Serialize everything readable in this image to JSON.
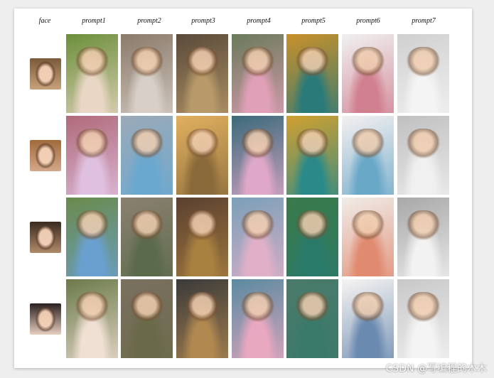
{
  "headers": [
    "face",
    "prompt1",
    "prompt2",
    "prompt3",
    "prompt4",
    "prompt5",
    "prompt6",
    "prompt7"
  ],
  "watermark": "CSDN @写编程的木木",
  "rows": [
    {
      "face_colors": [
        "#c9a27a",
        "#7a5a3a"
      ],
      "tiles": [
        [
          "#6b8f3a",
          "#e9d6c4"
        ],
        [
          "#8a7a6a",
          "#d8d0c8"
        ],
        [
          "#5a4a3a",
          "#b89a6a"
        ],
        [
          "#6a7a5a",
          "#e0a0b8"
        ],
        [
          "#c8902a",
          "#2a7a7a"
        ],
        [
          "#f0f0f0",
          "#d08090"
        ],
        [
          "#d0d0d0",
          "#f4f4f4"
        ]
      ]
    },
    {
      "face_colors": [
        "#d4a88a",
        "#a06a3a"
      ],
      "tiles": [
        [
          "#b06a7a",
          "#e0c0e0"
        ],
        [
          "#9aaab8",
          "#6aa8d0"
        ],
        [
          "#e0b060",
          "#8a6a3a"
        ],
        [
          "#3a6a7a",
          "#e0a8c8"
        ],
        [
          "#d0a030",
          "#2a8a8a"
        ],
        [
          "#f4f0f0",
          "#6aa8c8"
        ],
        [
          "#c0c0c0",
          "#f0f0f0"
        ]
      ]
    },
    {
      "face_colors": [
        "#b08a6a",
        "#3a2a20"
      ],
      "tiles": [
        [
          "#6a8a4a",
          "#6aa0d0"
        ],
        [
          "#8a8070",
          "#5a6a4a"
        ],
        [
          "#5a4030",
          "#a88040"
        ],
        [
          "#7aa0b8",
          "#e0b0c8"
        ],
        [
          "#3a7a4a",
          "#2a7a6a"
        ],
        [
          "#f0ece8",
          "#e08a70"
        ],
        [
          "#a8a8a8",
          "#f2f2f2"
        ]
      ]
    },
    {
      "face_colors": [
        "#e8cfc0",
        "#2a2020"
      ],
      "tiles": [
        [
          "#6a7a4a",
          "#f0e0d4"
        ],
        [
          "#7a7060",
          "#6a6a4a"
        ],
        [
          "#3a3a3a",
          "#b08850"
        ],
        [
          "#5a8aa0",
          "#e8a8c0"
        ],
        [
          "#4a7a6a",
          "#3a7a6a"
        ],
        [
          "#f6f4f2",
          "#6a8ab0"
        ],
        [
          "#c8c8c8",
          "#f4f4f4"
        ]
      ]
    }
  ]
}
